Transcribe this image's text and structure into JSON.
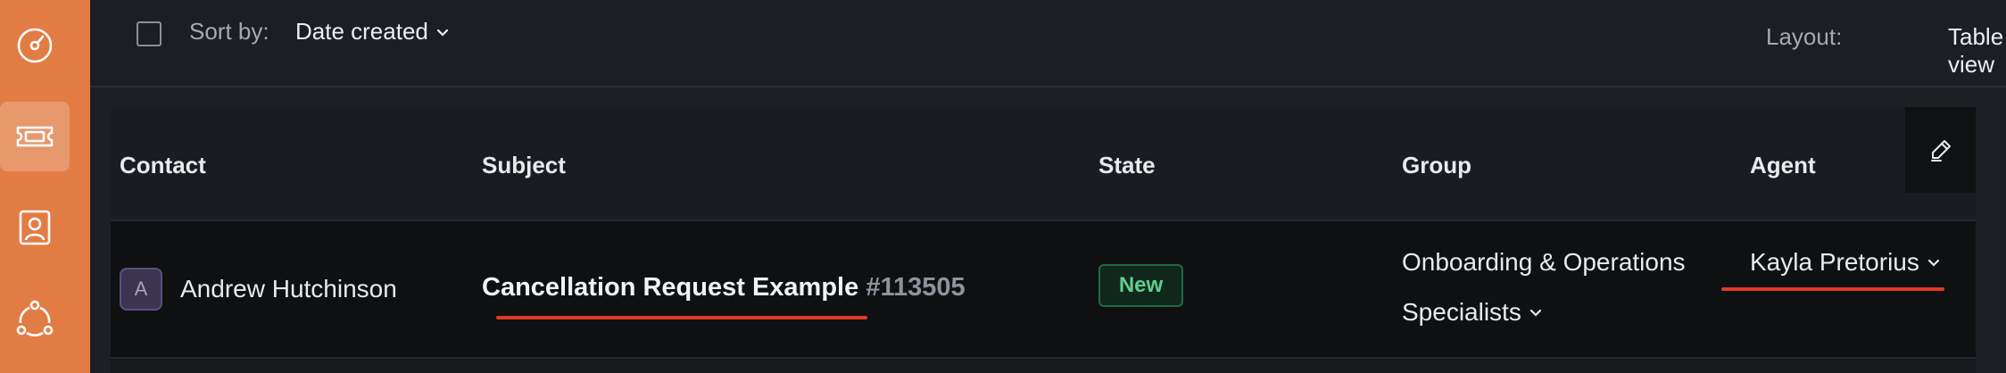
{
  "toolbar": {
    "sort_label": "Sort by:",
    "sort_value": "Date created",
    "layout_label": "Layout:",
    "layout_value": "Table view"
  },
  "sidebar": {
    "items": [
      {
        "icon": "dashboard-icon",
        "active": false
      },
      {
        "icon": "ticket-icon",
        "active": true
      },
      {
        "icon": "contact-card-icon",
        "active": false
      },
      {
        "icon": "network-icon",
        "active": false
      }
    ]
  },
  "table": {
    "columns": [
      "Contact",
      "Subject",
      "State",
      "Group",
      "Agent"
    ],
    "rows": [
      {
        "avatar_initial": "A",
        "contact": "Andrew Hutchinson",
        "subject_title": "Cancellation Request Example",
        "subject_id": "#113505",
        "state": "New",
        "group_line1": "Onboarding & Operations",
        "group_line2": "Specialists",
        "agent": "Kayla Pretorius"
      }
    ]
  },
  "colors": {
    "sidebar": "#e27c45",
    "background": "#1c1f23",
    "state_new": "#5fcf8e",
    "highlight_underline": "#e03b24"
  }
}
